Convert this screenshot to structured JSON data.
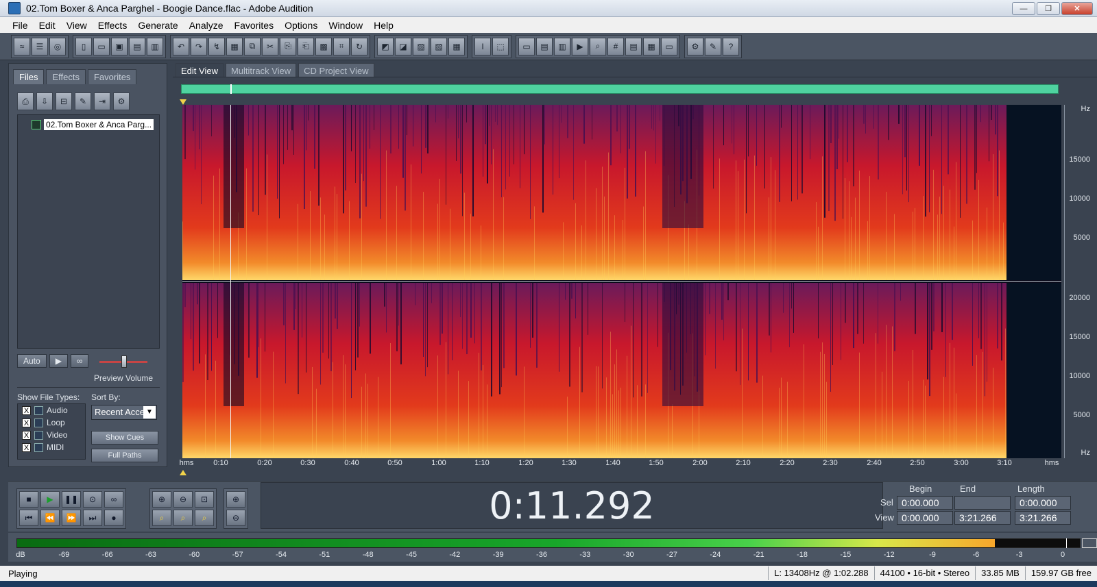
{
  "window": {
    "title": "02.Tom Boxer & Anca Parghel - Boogie Dance.flac - Adobe Audition"
  },
  "menu": [
    "File",
    "Edit",
    "View",
    "Effects",
    "Generate",
    "Analyze",
    "Favorites",
    "Options",
    "Window",
    "Help"
  ],
  "left_panel": {
    "tabs": [
      "Files",
      "Effects",
      "Favorites"
    ],
    "active_tab": "Files",
    "file_name": "02.Tom Boxer & Anca Parg...",
    "auto_label": "Auto",
    "volume_label": "Preview Volume",
    "show_file_types_label": "Show File Types:",
    "sort_by_label": "Sort By:",
    "file_types": [
      {
        "label": "Audio",
        "checked": "X"
      },
      {
        "label": "Loop",
        "checked": "X"
      },
      {
        "label": "Video",
        "checked": "X"
      },
      {
        "label": "MIDI",
        "checked": "X"
      }
    ],
    "sort_value": "Recent Acce",
    "show_cues_label": "Show Cues",
    "full_paths_label": "Full Paths"
  },
  "view_tabs": [
    "Edit View",
    "Multitrack View",
    "CD Project View"
  ],
  "active_view": "Edit View",
  "timeline": {
    "start_label": "hms",
    "end_label": "hms",
    "ticks": [
      "0:10",
      "0:20",
      "0:30",
      "0:40",
      "0:50",
      "1:00",
      "1:10",
      "1:20",
      "1:30",
      "1:40",
      "1:50",
      "2:00",
      "2:10",
      "2:20",
      "2:30",
      "2:40",
      "2:50",
      "3:00",
      "3:10"
    ]
  },
  "hz_scale": {
    "top_channel": [
      "Hz",
      "15000",
      "10000",
      "5000"
    ],
    "bottom_channel": [
      "20000",
      "15000",
      "10000",
      "5000",
      "Hz"
    ]
  },
  "time_display": "0:11.292",
  "selection": {
    "headers": [
      "Begin",
      "End",
      "Length"
    ],
    "sel_label": "Sel",
    "view_label": "View",
    "sel": [
      "0:00.000",
      "",
      "0:00.000"
    ],
    "view": [
      "0:00.000",
      "3:21.266",
      "3:21.266"
    ]
  },
  "meter": {
    "level_fraction": 0.92,
    "labels": [
      "dB",
      "-69",
      "-66",
      "-63",
      "-60",
      "-57",
      "-54",
      "-51",
      "-48",
      "-45",
      "-42",
      "-39",
      "-36",
      "-33",
      "-30",
      "-27",
      "-24",
      "-21",
      "-18",
      "-15",
      "-12",
      "-9",
      "-6",
      "-3",
      "0"
    ]
  },
  "status": {
    "state": "Playing",
    "cursor": "L: 13408Hz @   1:02.288",
    "format": "44100 • 16-bit • Stereo",
    "size": "33.85 MB",
    "free": "159.97 GB free"
  }
}
